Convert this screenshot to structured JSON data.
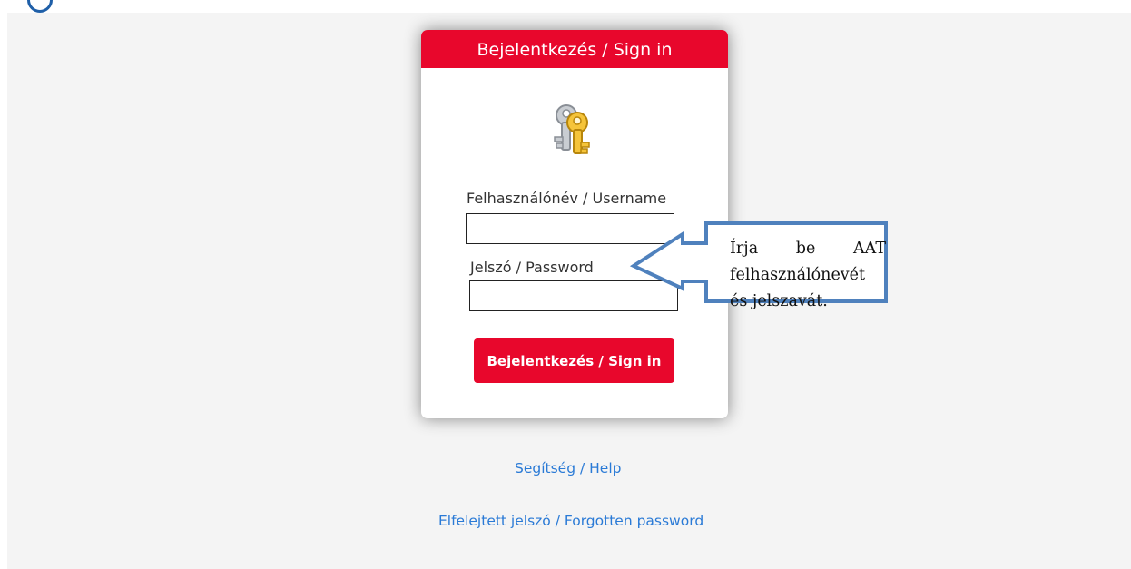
{
  "login_card": {
    "header_title": "Bejelentkezés / Sign in",
    "username_label": "Felhasználónév / Username",
    "username_value": "",
    "password_label": "Jelszó / Password",
    "password_value": "",
    "submit_label": "Bejelentkezés / Sign in",
    "key_icon": "keys-icon"
  },
  "links": {
    "help": "Segítség / Help",
    "forgot_password": "Elfelejtett jelszó / Forgotten password"
  },
  "callout": {
    "text": "Írja be AAT felhasználónevét és jelszavát."
  },
  "colors": {
    "accent": "#e8072c",
    "link": "#2a7ad6",
    "callout_border": "#4f81bd",
    "background": "#f4f4f4"
  }
}
